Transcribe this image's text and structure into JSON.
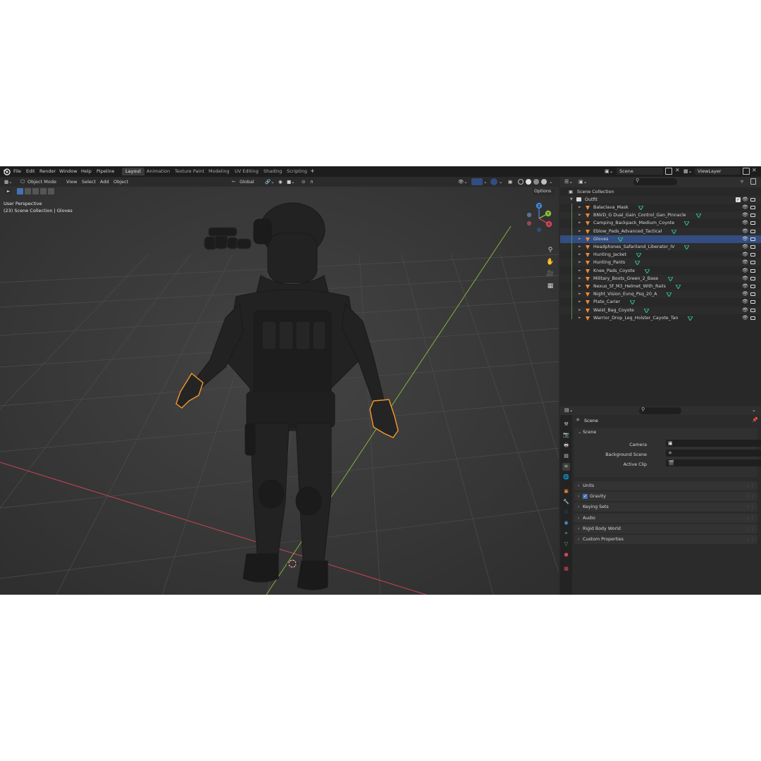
{
  "top_menu": [
    "File",
    "Edit",
    "Render",
    "Window",
    "Help",
    "Pipeline"
  ],
  "workspace_tabs": [
    "Layout",
    "Animation",
    "Texture Paint",
    "Modeling",
    "UV Editing",
    "Shading",
    "Scripting"
  ],
  "active_workspace": "Layout",
  "add_workspace_symbol": "+",
  "scene_field": "Scene",
  "viewlayer_field": "ViewLayer",
  "viewport": {
    "mode": "Object Mode",
    "menus": [
      "View",
      "Select",
      "Add",
      "Object"
    ],
    "transform_orientation": "Global",
    "options_label": "Options",
    "perspective_label": "User Perspective",
    "context_label": "(23) Scene Collection | Gloves",
    "gizmo_axes": [
      "X",
      "Y",
      "Z"
    ]
  },
  "outliner": {
    "root": "Scene Collection",
    "collection": "Outfit",
    "items": [
      {
        "label": "Balaclava_Mask",
        "selected": false
      },
      {
        "label": "BNVD_G Dual_Gain_Control_Gan_Pinnacle",
        "selected": false
      },
      {
        "label": "Camping_Backpack_Medium_Coyote",
        "selected": false
      },
      {
        "label": "Eblow_Pads_Advanced_Tactical",
        "selected": false
      },
      {
        "label": "Gloves",
        "selected": true
      },
      {
        "label": "Headphones_Safariland_Liberator_IV",
        "selected": false
      },
      {
        "label": "Hunting_Jacket",
        "selected": false
      },
      {
        "label": "Hunting_Pants",
        "selected": false
      },
      {
        "label": "Knee_Pads_Coyote",
        "selected": false
      },
      {
        "label": "Military_Boots_Green_2_Base",
        "selected": false
      },
      {
        "label": "Nexus_Sf_M3_Helmet_With_Rails",
        "selected": false
      },
      {
        "label": "Night_Vision_Evnq_Psq_20_A",
        "selected": false
      },
      {
        "label": "Plate_Carier",
        "selected": false
      },
      {
        "label": "Waist_Bag_Coyote",
        "selected": false
      },
      {
        "label": "Warrior_Drop_Leg_Holster_Cayote_Tan",
        "selected": false
      }
    ]
  },
  "properties": {
    "breadcrumb": "Scene",
    "scene_panel": "Scene",
    "fields": [
      {
        "label": "Camera"
      },
      {
        "label": "Background Scene"
      },
      {
        "label": "Active Clip"
      }
    ],
    "panels": [
      {
        "label": "Units",
        "checkbox": false
      },
      {
        "label": "Gravity",
        "checkbox": true
      },
      {
        "label": "Keying Sets",
        "checkbox": false
      },
      {
        "label": "Audio",
        "checkbox": false
      },
      {
        "label": "Rigid Body World",
        "checkbox": false
      },
      {
        "label": "Custom Properties",
        "checkbox": false
      }
    ]
  },
  "colors": {
    "selection_outline": "#f59a2c",
    "selected_row": "#334d80",
    "x_axis": "#d9455a",
    "y_axis": "#8bbf3c",
    "z_axis": "#3f88d6",
    "mesh_icon": "#36c48a",
    "object_icon": "#ee8a3a"
  },
  "icons": {
    "blender_logo": "blender-logo-icon",
    "zoom": "magnifier-icon",
    "pan": "hand-icon",
    "camera": "camera-icon",
    "grid": "grid-icon"
  }
}
